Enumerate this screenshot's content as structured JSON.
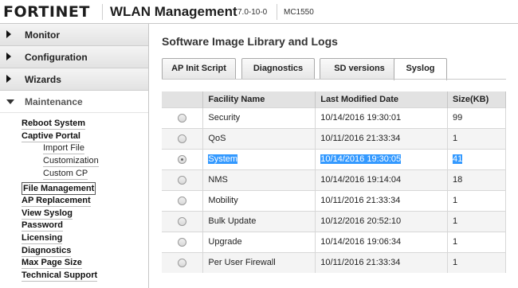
{
  "header": {
    "logo_text": "FORTINET",
    "app_title": "WLAN Management",
    "version": "7.0-10-0",
    "model": "MC1550"
  },
  "sidebar": {
    "sections": [
      {
        "label": "Monitor",
        "state": "collapsed"
      },
      {
        "label": "Configuration",
        "state": "collapsed"
      },
      {
        "label": "Wizards",
        "state": "collapsed"
      },
      {
        "label": "Maintenance",
        "state": "expanded"
      }
    ],
    "items": [
      {
        "label": "Reboot System"
      },
      {
        "label": "Captive Portal"
      },
      {
        "label": "Import File"
      },
      {
        "label": "Customization"
      },
      {
        "label": "Custom CP"
      },
      {
        "label": "File Management"
      },
      {
        "label": "AP Replacement"
      },
      {
        "label": "View Syslog"
      },
      {
        "label": "Password"
      },
      {
        "label": "Licensing"
      },
      {
        "label": "Diagnostics"
      },
      {
        "label": "Max Page Size"
      },
      {
        "label": "Technical Support"
      }
    ]
  },
  "main": {
    "title": "Software Image Library and Logs",
    "tabs": [
      {
        "label": "AP Init Script"
      },
      {
        "label": "Diagnostics"
      },
      {
        "label": "SD versions"
      },
      {
        "label": "Syslog",
        "active": true
      }
    ],
    "table": {
      "columns": [
        "",
        "Facility Name",
        "Last Modified Date",
        "Size(KB)"
      ],
      "rows": [
        {
          "name": "Security",
          "date": "10/14/2016 19:30:01",
          "size": "99"
        },
        {
          "name": "QoS",
          "date": "10/11/2016 21:33:34",
          "size": "1"
        },
        {
          "name": "System",
          "date": "10/14/2016 19:30:05",
          "size": "41",
          "selected": true
        },
        {
          "name": "NMS",
          "date": "10/14/2016 19:14:04",
          "size": "18"
        },
        {
          "name": "Mobility",
          "date": "10/11/2016 21:33:34",
          "size": "1"
        },
        {
          "name": "Bulk Update",
          "date": "10/12/2016 20:52:10",
          "size": "1"
        },
        {
          "name": "Upgrade",
          "date": "10/14/2016 19:06:34",
          "size": "1"
        },
        {
          "name": "Per User Firewall",
          "date": "10/11/2016 21:33:34",
          "size": "1"
        }
      ]
    }
  },
  "colors": {
    "selection": "#3399ff",
    "header_gray": "#e2e2e2",
    "row_alt": "#f4f4f4"
  }
}
